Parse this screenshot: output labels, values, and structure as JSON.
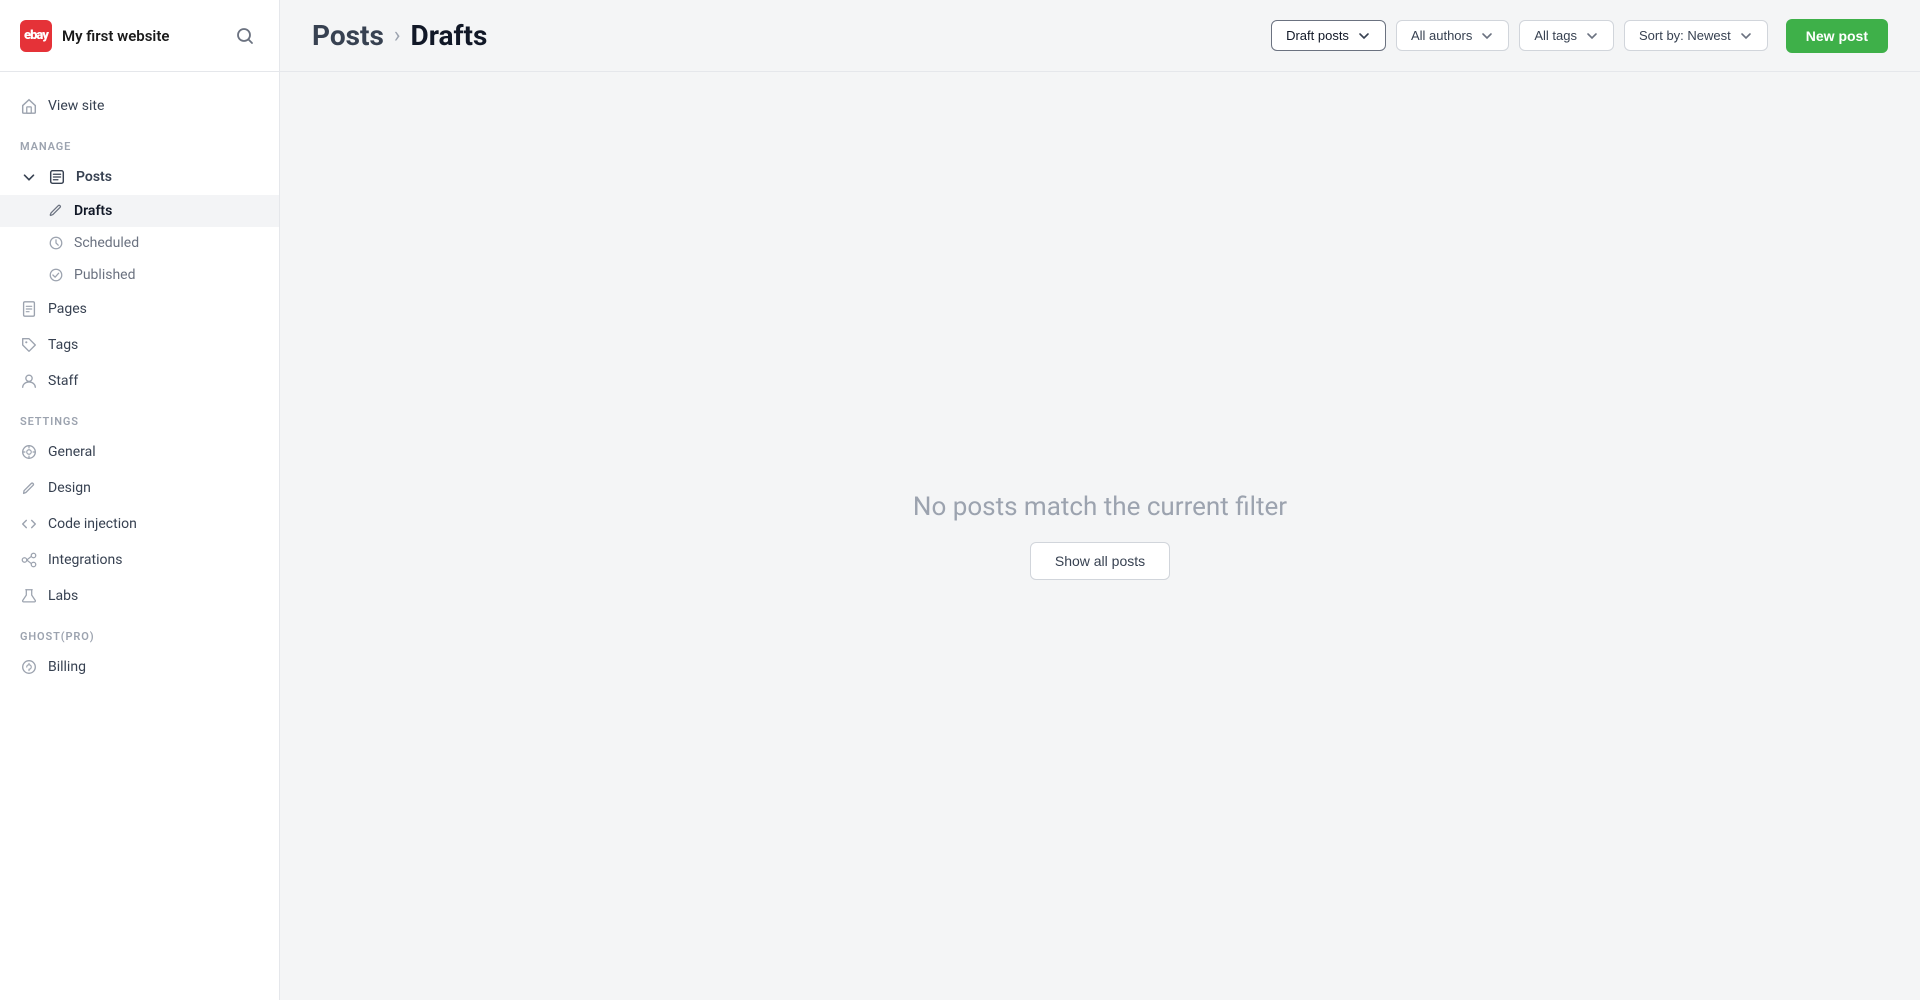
{
  "brand": {
    "logo_text": "ebay",
    "site_name": "My first website"
  },
  "header": {
    "breadcrumb_parent": "Posts",
    "breadcrumb_separator": "›",
    "breadcrumb_current": "Drafts",
    "new_post_label": "New post"
  },
  "filters": {
    "posts_filter": "Draft posts",
    "authors_filter": "All authors",
    "tags_filter": "All tags",
    "sort_filter": "Sort by: Newest"
  },
  "sidebar": {
    "manage_label": "MANAGE",
    "settings_label": "SETTINGS",
    "ghost_pro_label": "GHOST(PRO)",
    "nav_items": [
      {
        "id": "view-site",
        "label": "View site"
      }
    ],
    "posts_label": "Posts",
    "sub_items": [
      {
        "id": "drafts",
        "label": "Drafts",
        "active": true
      },
      {
        "id": "scheduled",
        "label": "Scheduled"
      },
      {
        "id": "published",
        "label": "Published"
      }
    ],
    "manage_items": [
      {
        "id": "pages",
        "label": "Pages"
      },
      {
        "id": "tags",
        "label": "Tags"
      },
      {
        "id": "staff",
        "label": "Staff"
      }
    ],
    "settings_items": [
      {
        "id": "general",
        "label": "General"
      },
      {
        "id": "design",
        "label": "Design"
      },
      {
        "id": "code-injection",
        "label": "Code injection"
      },
      {
        "id": "integrations",
        "label": "Integrations"
      },
      {
        "id": "labs",
        "label": "Labs"
      }
    ],
    "ghost_pro_items": [
      {
        "id": "billing",
        "label": "Billing"
      }
    ]
  },
  "content": {
    "empty_message": "No posts match the current filter",
    "show_all_label": "Show all posts"
  }
}
